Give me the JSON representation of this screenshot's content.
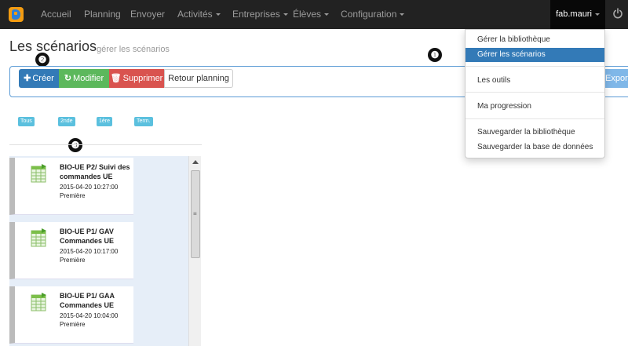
{
  "navbar": {
    "items": [
      {
        "label": "Accueil"
      },
      {
        "label": "Planning"
      },
      {
        "label": "Envoyer"
      },
      {
        "label": "Activités"
      },
      {
        "label": "Entreprises"
      },
      {
        "label": "Élèves"
      },
      {
        "label": "Configuration"
      }
    ],
    "user": "fab.mauri"
  },
  "page": {
    "title": "Les scénarios",
    "subtitle": "gérer les scénarios"
  },
  "callouts": [
    "❶",
    "❷",
    "❸"
  ],
  "toolbar": {
    "create": "Créer",
    "modify": "Modifier",
    "delete": "Supprimer",
    "back": "Retour planning",
    "export": "Exporte"
  },
  "filters": [
    "Tous",
    "2nde",
    "1ère",
    "Term."
  ],
  "scenarios": [
    {
      "title": "BIO-UE P2/ Suivi des commandes UE",
      "date": "2015-04-20 10:27:00",
      "level": "Première"
    },
    {
      "title": "BIO-UE P1/ GAV Commandes UE",
      "date": "2015-04-20 10:17:00",
      "level": "Première"
    },
    {
      "title": "BIO-UE P1/ GAA Commandes UE",
      "date": "2015-04-20 10:04:00",
      "level": "Première"
    }
  ],
  "dropdown": {
    "items": [
      {
        "label": "Gérer la bibliothèque",
        "active": false
      },
      {
        "label": "Gérer les scénarios",
        "active": true
      },
      {
        "label": "Les outils",
        "active": false
      },
      {
        "label": "Ma progression",
        "active": false
      },
      {
        "label": "Sauvegarder la bibliothèque",
        "active": false
      },
      {
        "label": "Sauvegarder la base de données",
        "active": false
      }
    ]
  },
  "colors": {
    "navbar": "#222222",
    "primary": "#337ab7",
    "success": "#5cb85c",
    "danger": "#d9534f",
    "info": "#5bc0de",
    "logo": "#f39c12"
  },
  "icons": {
    "create": "plus-icon",
    "modify": "refresh-icon",
    "delete": "trash-icon",
    "power": "power-icon",
    "scenario": "spreadsheet-icon"
  }
}
